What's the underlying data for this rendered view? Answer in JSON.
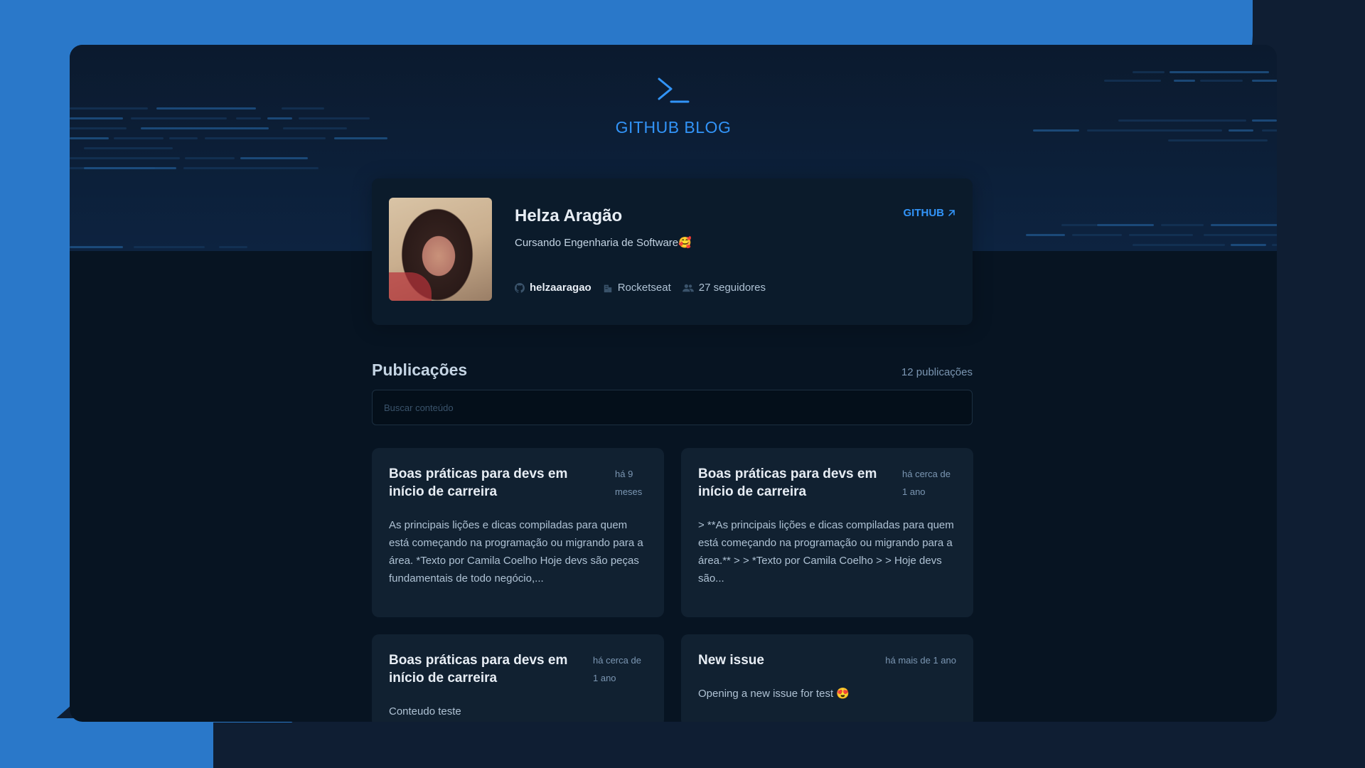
{
  "brand": {
    "title": "GITHUB BLOG",
    "accent_color": "#3294f8"
  },
  "profile": {
    "name": "Helza Aragão",
    "bio": "Cursando Engenharia de Software🥰",
    "github_link": "GITHUB",
    "username": "helzaaragao",
    "company": "Rocketseat",
    "followers": "27 seguidores",
    "icons": {
      "username": "github-icon",
      "company": "building-icon",
      "followers": "users-icon",
      "link": "external-arrow-icon"
    }
  },
  "publications": {
    "title": "Publicações",
    "count": "12 publicações",
    "search_placeholder": "Buscar conteúdo",
    "posts": [
      {
        "title": "Boas práticas para devs em início de carreira",
        "date": "há 9 meses",
        "excerpt": "As principais lições e dicas compiladas para quem está começando na programação ou migrando para a área. *Texto por Camila Coelho Hoje devs são peças fundamentais de todo negócio,..."
      },
      {
        "title": "Boas práticas para devs em início de carreira",
        "date": "há cerca de 1 ano",
        "excerpt": "> **As principais lições e dicas compiladas para quem está começando na programação ou migrando para a área.** > > *Texto por Camila Coelho > > Hoje devs são..."
      },
      {
        "title": "Boas práticas para devs em início de carreira",
        "date": "há cerca de 1 ano",
        "excerpt": "Conteudo teste"
      },
      {
        "title": "New issue",
        "date": "há mais de 1 ano",
        "excerpt": "Opening a new issue for test 😍"
      }
    ]
  }
}
